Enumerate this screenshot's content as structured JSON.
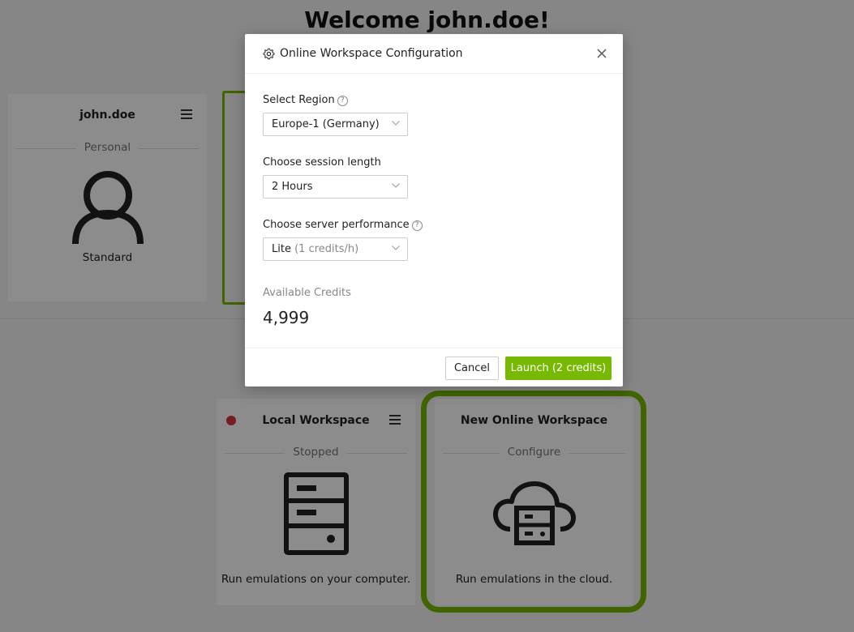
{
  "page": {
    "welcome": "Welcome john.doe!"
  },
  "user_card": {
    "title": "john.doe",
    "subtitle": "Personal",
    "description": "Standard"
  },
  "local_workspace": {
    "title": "Local Workspace",
    "status": "Stopped",
    "description": "Run emulations on your computer.",
    "status_color": "#d9363e"
  },
  "online_workspace": {
    "title": "New Online Workspace",
    "status": "Configure",
    "description": "Run emulations in the cloud."
  },
  "modal": {
    "title": "Online Workspace Configuration",
    "region": {
      "label": "Select Region",
      "value": "Europe-1 (Germany)"
    },
    "session": {
      "label": "Choose session length",
      "value": "2 Hours"
    },
    "performance": {
      "label": "Choose server performance",
      "value": "Lite",
      "value_detail": "(1 credits/h)"
    },
    "credits": {
      "label": "Available Credits",
      "value": "4,999"
    },
    "cancel_label": "Cancel",
    "launch_label": "Launch (2 credits)"
  },
  "colors": {
    "accent": "#76b900",
    "status_stopped": "#d9363e"
  }
}
